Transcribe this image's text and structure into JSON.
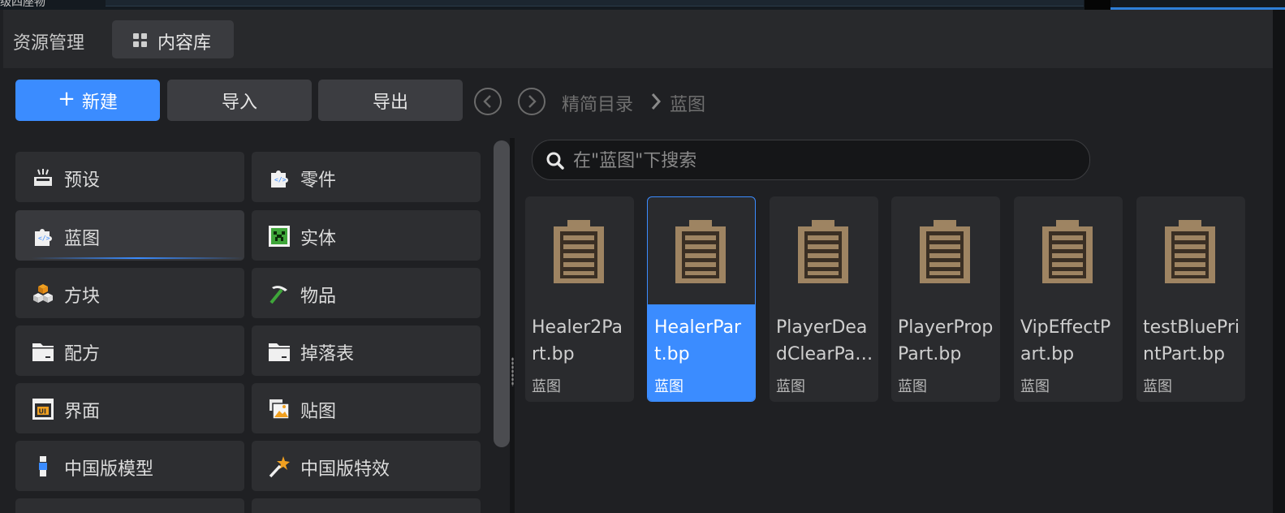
{
  "topbar": {
    "clipped_text": "级四座物"
  },
  "header": {
    "title": "资源管理",
    "tab_label": "内容库"
  },
  "toolbar": {
    "new_label": "新建",
    "import_label": "导入",
    "export_label": "导出",
    "breadcrumb": {
      "root": "精简目录",
      "current": "蓝图"
    }
  },
  "categories": [
    {
      "label": "预设",
      "icon": "tray-icon"
    },
    {
      "label": "零件",
      "icon": "code-puzzle-icon"
    },
    {
      "label": "蓝图",
      "icon": "blueprint-puzzle-icon",
      "active": true
    },
    {
      "label": "实体",
      "icon": "creeper-icon"
    },
    {
      "label": "方块",
      "icon": "blocks-icon"
    },
    {
      "label": "物品",
      "icon": "pickaxe-icon"
    },
    {
      "label": "配方",
      "icon": "folder-icon"
    },
    {
      "label": "掉落表",
      "icon": "folder-icon"
    },
    {
      "label": "界面",
      "icon": "ui-window-icon"
    },
    {
      "label": "贴图",
      "icon": "image-stack-icon"
    },
    {
      "label": "中国版模型",
      "icon": "model-figure-icon"
    },
    {
      "label": "中国版特效",
      "icon": "magic-wand-icon"
    }
  ],
  "search": {
    "placeholder": "在\"蓝图\"下搜索"
  },
  "files": [
    {
      "name": "Healer2Part.bp",
      "type": "蓝图",
      "selected": false
    },
    {
      "name": "HealerPart.bp",
      "type": "蓝图",
      "selected": true
    },
    {
      "name": "PlayerDeadClearPart.bp",
      "type": "蓝图",
      "selected": false
    },
    {
      "name": "PlayerPropPart.bp",
      "type": "蓝图",
      "selected": false
    },
    {
      "name": "VipEffectPart.bp",
      "type": "蓝图",
      "selected": false
    },
    {
      "name": "testBluePrintPart.bp",
      "type": "蓝图",
      "selected": false
    }
  ],
  "colors": {
    "accent": "#3b8cff",
    "clipboard": "#9e8462"
  }
}
